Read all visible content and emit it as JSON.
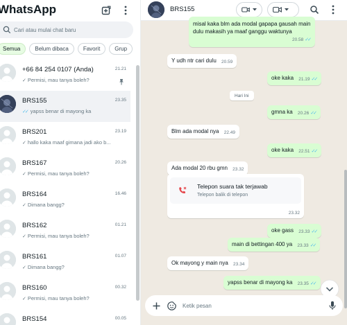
{
  "app": {
    "title": "WhatsApp"
  },
  "left": {
    "search_placeholder": "Cari atau mulai chat baru",
    "filters": [
      "Semua",
      "Belum dibaca",
      "Favorit",
      "Grup"
    ],
    "active_filter": "Semua",
    "chats": [
      {
        "name": "+66 84 254 0107 (Anda)",
        "time": "21.21",
        "tick": "single",
        "preview": "Permisi, mau tanya boleh?",
        "pinned": true,
        "avatar": "default"
      },
      {
        "name": "BRS155",
        "time": "23.35",
        "tick": "read",
        "preview": "yapss benar di mayong ka",
        "pinned": false,
        "avatar": "photo",
        "selected": true
      },
      {
        "name": "BRS201",
        "time": "23.19",
        "tick": "single",
        "preview": "hallo kaka maaf gimana jadi ako b...",
        "pinned": false,
        "avatar": "default"
      },
      {
        "name": "BRS167",
        "time": "20.26",
        "tick": "single",
        "preview": "Permisi, mau tanya boleh?",
        "pinned": false,
        "avatar": "default"
      },
      {
        "name": "BRS164",
        "time": "16.46",
        "tick": "single",
        "preview": "Dimana bangg?",
        "pinned": false,
        "avatar": "default"
      },
      {
        "name": "BRS162",
        "time": "01.21",
        "tick": "single",
        "preview": "Permisi, mau tanya boleh?",
        "pinned": false,
        "avatar": "default"
      },
      {
        "name": "BRS161",
        "time": "01.07",
        "tick": "single",
        "preview": "Dimana bangg?",
        "pinned": false,
        "avatar": "default"
      },
      {
        "name": "BRS160",
        "time": "00.32",
        "tick": "single",
        "preview": "Permisi, mau tanya boleh?",
        "pinned": false,
        "avatar": "default"
      },
      {
        "name": "BRS154",
        "time": "00.05",
        "tick": "single",
        "preview": "",
        "pinned": false,
        "avatar": "default"
      }
    ]
  },
  "conversation": {
    "contact_name": "BRS155",
    "composer_placeholder": "Ketik pesan",
    "date_separator": "Hari Ini",
    "messages": [
      {
        "dir": "out",
        "text": "misal kaka blm ada modal gapapa gausah main dulu makasih ya maaf ganggu waktunya",
        "time": "20.58",
        "multiline": true
      },
      {
        "dir": "in",
        "text": "Y udh ntr cari dulu",
        "time": "20.59"
      },
      {
        "dir": "out",
        "text": "oke kaka",
        "time": "21.19"
      },
      {
        "dir": "out",
        "text": "gmna ka",
        "time": "20.26"
      },
      {
        "dir": "in",
        "text": "Blm ada modal nya",
        "time": "22.49"
      },
      {
        "dir": "out",
        "text": "oke kaka",
        "time": "22.51"
      },
      {
        "dir": "in",
        "text": "Ada modal 20 rbu gmn",
        "time": "23.32"
      },
      {
        "dir": "out",
        "text": "oke gass",
        "time": "23.33"
      },
      {
        "dir": "out",
        "text": "main di bettingan 400 ya",
        "time": "23.33"
      },
      {
        "dir": "in",
        "text": "Ok mayong y main nya",
        "time": "23.34"
      },
      {
        "dir": "out",
        "text": "yapss benar di mayong ka",
        "time": "23.35"
      }
    ],
    "call": {
      "title": "Telepon suara tak terjawab",
      "subtitle": "Telepon balik di telepon",
      "time": "23.32"
    }
  },
  "colors": {
    "accent": "#25d366",
    "read_tick": "#53bdeb",
    "outgoing_bubble": "#d9fdd3",
    "chat_bg": "#efeae2",
    "missed_call": "#e5484d"
  }
}
